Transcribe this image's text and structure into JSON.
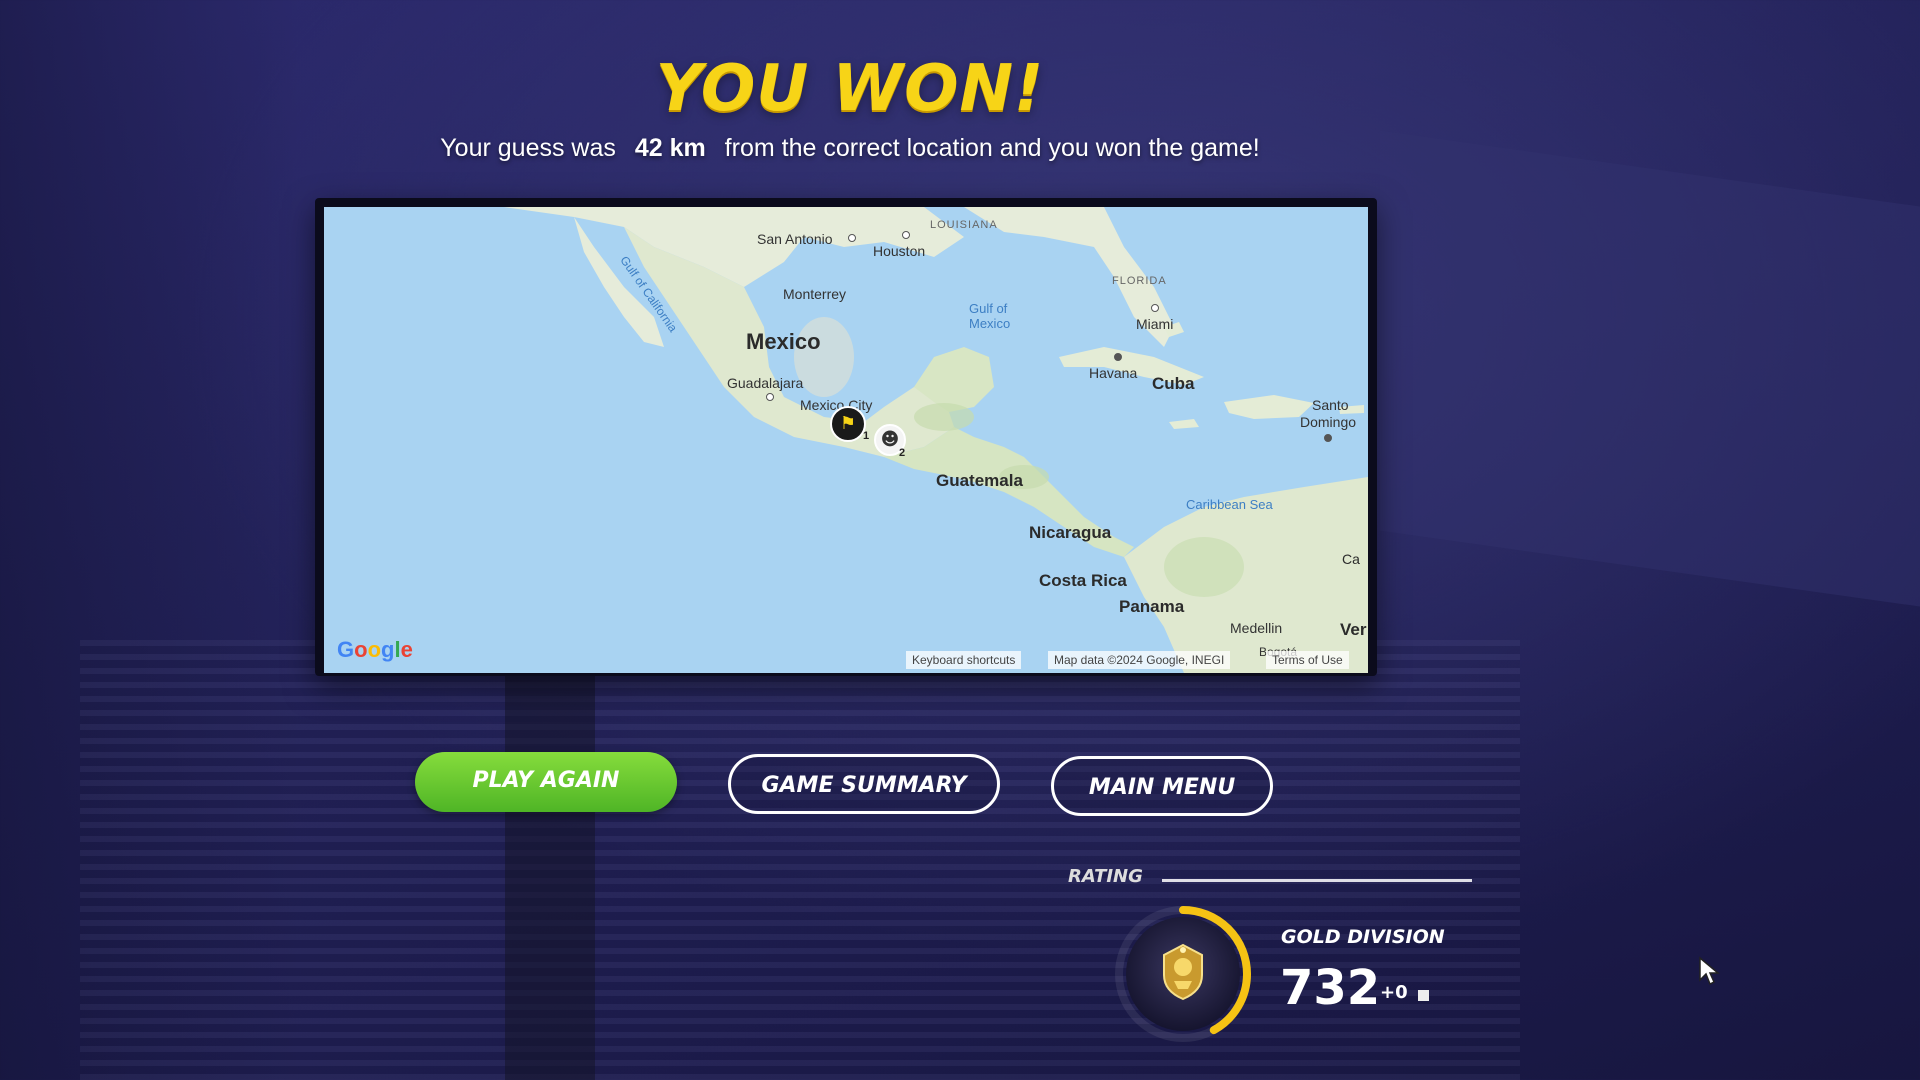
{
  "result": {
    "title": "YOU WON!",
    "subtitle_prefix": "Your guess was",
    "distance": "42 km",
    "subtitle_suffix": "from the correct location and you won the game!"
  },
  "map": {
    "labels": {
      "mexico": "Mexico",
      "guatemala": "Guatemala",
      "nicaragua": "Nicaragua",
      "costa_rica": "Costa Rica",
      "panama": "Panama",
      "cuba": "Cuba",
      "san_antonio": "San Antonio",
      "houston": "Houston",
      "monterrey": "Monterrey",
      "guadalajara": "Guadalajara",
      "mexico_city": "Mexico City",
      "havana": "Havana",
      "miami": "Miami",
      "santo_domingo_1": "Santo",
      "santo_domingo_2": "Domingo",
      "medellin": "Medellin",
      "bogota": "Bogotá",
      "louisiana": "LOUISIANA",
      "florida": "FLORIDA",
      "gulf_of_mexico_1": "Gulf of",
      "gulf_of_mexico_2": "Mexico",
      "gulf_of_california": "Gulf of California",
      "caribbean_sea": "Caribbean Sea",
      "ca_partial": "Ca",
      "ve_partial": "Ver"
    },
    "markers": {
      "correct_location_label": "1",
      "player_guess_label": "2",
      "correct_location_icon": "flag-icon",
      "player_guess_icon": "avatar-icon"
    },
    "logo": "Google",
    "attribution": {
      "keyboard_shortcuts": "Keyboard shortcuts",
      "map_data": "Map data ©2024 Google, INEGI",
      "terms": "Terms of Use"
    }
  },
  "buttons": {
    "play_again": "PLAY AGAIN",
    "game_summary": "GAME SUMMARY",
    "main_menu": "MAIN MENU"
  },
  "rating": {
    "label": "RATING",
    "division": "GOLD DIVISION",
    "value": "732",
    "delta": "+0",
    "progress": 0.42,
    "badge_icon": "gold-division-badge-icon"
  },
  "colors": {
    "title_yellow": "#f7d417",
    "play_green": "#5fc42c",
    "background": "#24235c",
    "ocean": "#a9d3f2",
    "land": "#e9efdf",
    "rating_ring": "#f5c314"
  }
}
